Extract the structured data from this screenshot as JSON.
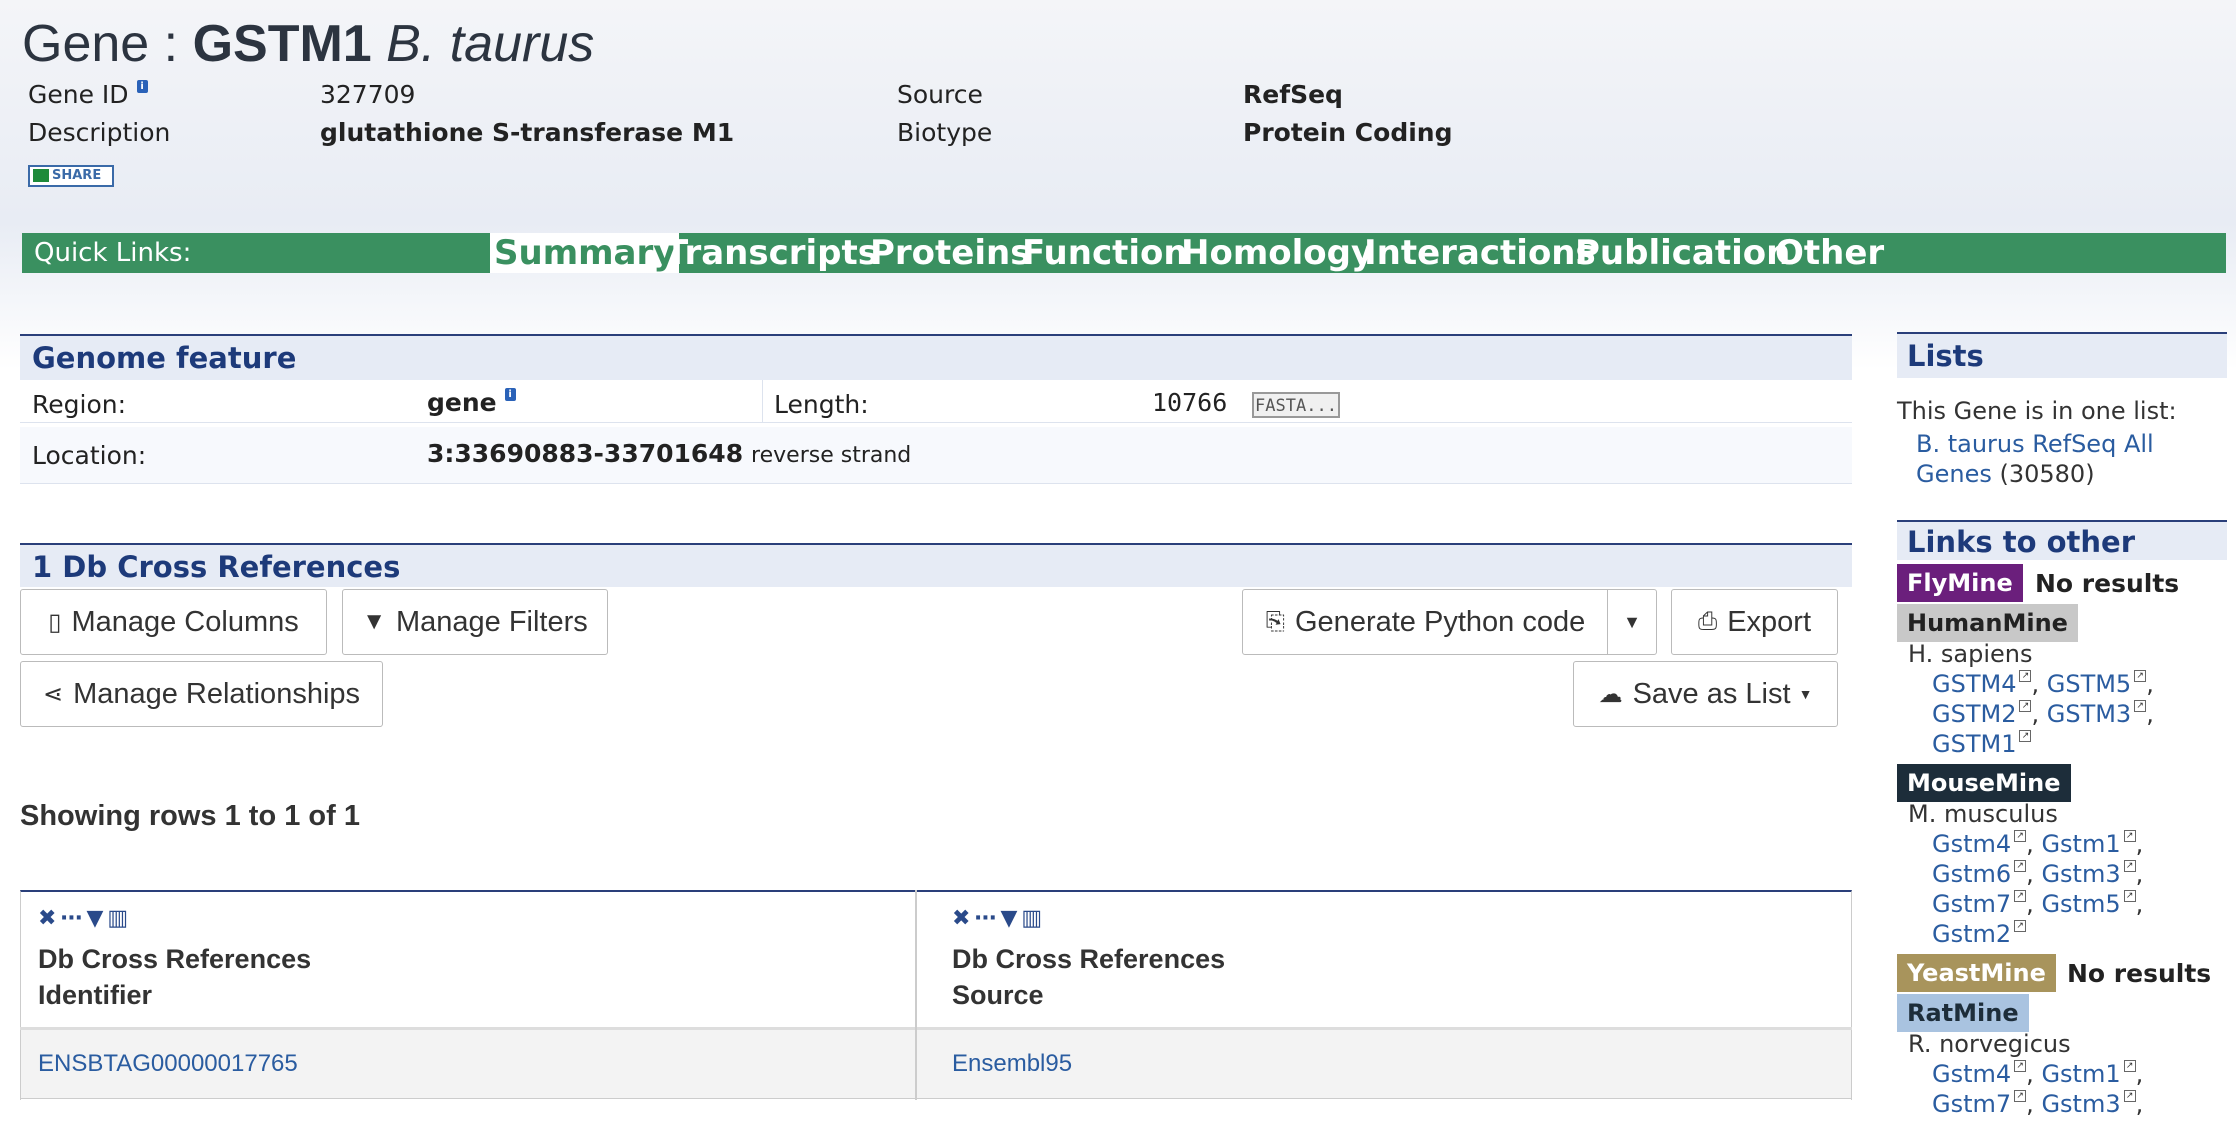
{
  "header": {
    "title_prefix": "Gene : ",
    "title_symbol": "GSTM1",
    "title_organism": "B. taurus",
    "gene_id_label": "Gene ID",
    "gene_id_value": "327709",
    "description_label": "Description",
    "description_value": "glutathione S-transferase M1",
    "source_label": "Source",
    "source_value": "RefSeq",
    "biotype_label": "Biotype",
    "biotype_value": "Protein Coding",
    "share_label": "SHARE"
  },
  "quick_links": {
    "label": "Quick Links:",
    "tabs": [
      "Summary",
      "Transcripts",
      "Proteins",
      "Function",
      "Homology",
      "Interactions",
      "Publication",
      "Other"
    ]
  },
  "genome_feature": {
    "heading": "Genome feature",
    "region_label": "Region:",
    "region_value": "gene",
    "length_label": "Length:",
    "length_value": "10766",
    "fasta_label": "FASTA...",
    "location_label": "Location:",
    "location_value": "3:33690883-33701648",
    "strand": "reverse strand"
  },
  "db_refs": {
    "heading": "1 Db Cross References",
    "buttons": {
      "manage_columns": "Manage Columns",
      "manage_filters": "Manage Filters",
      "generate_python": "Generate Python code",
      "export": "Export",
      "manage_relationships": "Manage Relationships",
      "save_as_list": "Save as List"
    },
    "showing": "Showing rows 1 to 1 of 1",
    "columns": [
      {
        "line1": "Db Cross References",
        "line2": "Identifier"
      },
      {
        "line1": "Db Cross References",
        "line2": "Source"
      }
    ],
    "rows": [
      {
        "identifier": "ENSBTAG00000017765",
        "source": "Ensembl95"
      }
    ]
  },
  "lists": {
    "heading": "Lists",
    "intro": "This Gene is in one list:",
    "list_name_line1": "B. taurus RefSeq All",
    "list_name_line2": "Genes",
    "list_count": "(30580)"
  },
  "other_mines": {
    "heading": "Links to other Mines",
    "flymine": {
      "name": "FlyMine",
      "result": "No results",
      "color": "#6b1f7c"
    },
    "humanmine": {
      "name": "HumanMine",
      "color": "#c8c8c8",
      "organism": "H. sapiens",
      "genes": [
        [
          "GSTM4",
          "GSTM5"
        ],
        [
          "GSTM2",
          "GSTM3"
        ],
        [
          "GSTM1"
        ]
      ]
    },
    "mousemine": {
      "name": "MouseMine",
      "color": "#1d2d3a",
      "organism": "M. musculus",
      "genes": [
        [
          "Gstm4",
          "Gstm1"
        ],
        [
          "Gstm6",
          "Gstm3"
        ],
        [
          "Gstm7",
          "Gstm5"
        ],
        [
          "Gstm2"
        ]
      ]
    },
    "yeastmine": {
      "name": "YeastMine",
      "result": "No results",
      "color": "#a8945c"
    },
    "ratmine": {
      "name": "RatMine",
      "color": "#a9c3e0",
      "organism": "R. norvegicus",
      "genes": [
        [
          "Gstm4",
          "Gstm1"
        ],
        [
          "Gstm7",
          "Gstm3"
        ]
      ]
    }
  },
  "colors": {
    "quick_links_bar": "#3a9060",
    "section_border": "#2a3f7a",
    "link": "#2a5ca0"
  }
}
